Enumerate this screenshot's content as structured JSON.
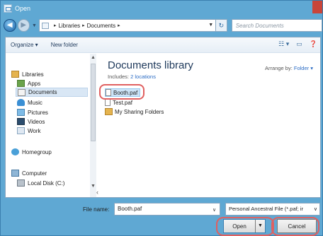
{
  "window": {
    "title": "Open"
  },
  "address": {
    "crumbs": [
      "Libraries",
      "Documents"
    ],
    "search_placeholder": "Search Documents"
  },
  "toolbar": {
    "organize": "Organize ▾",
    "new_folder": "New folder"
  },
  "nav": {
    "libraries": "Libraries",
    "apps": "Apps",
    "documents": "Documents",
    "music": "Music",
    "pictures": "Pictures",
    "videos": "Videos",
    "work": "Work",
    "homegroup": "Homegroup",
    "computer": "Computer",
    "local_disk": "Local Disk (C:)"
  },
  "main": {
    "title": "Documents library",
    "includes_prefix": "Includes: ",
    "includes_link": "2 locations",
    "arrange_label": "Arrange by: ",
    "arrange_value": "Folder ▾",
    "files": [
      "Booth.paf",
      "Test.paf",
      "My Sharing Folders"
    ]
  },
  "footer": {
    "file_name_label": "File name:",
    "file_name_value": "Booth.paf",
    "filter_value": "Personal Ancestral File (*.paf; ir",
    "open_label": "Open",
    "cancel_label": "Cancel"
  },
  "colors": {
    "highlight": "#e06060",
    "link": "#2a6bc4",
    "chrome": "#5fa8d3"
  }
}
